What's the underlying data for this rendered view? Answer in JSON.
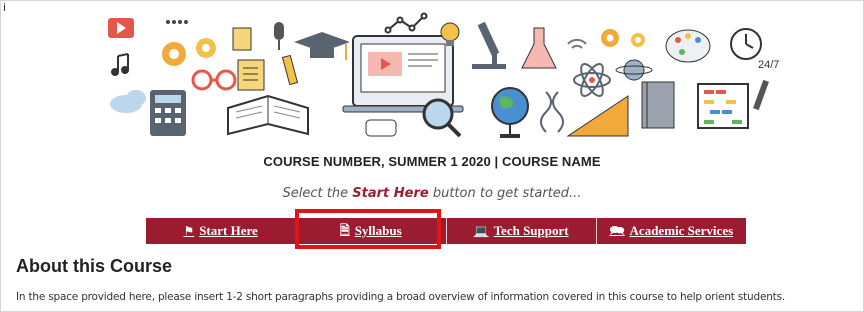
{
  "cursor_glyph": "i",
  "banner": {
    "clock_label": "24/7",
    "icons": [
      "video-play-icon",
      "gear-icon",
      "checklist-icon",
      "microphone-icon",
      "graduation-cap-icon",
      "laptop-video-icon",
      "line-chart-icon",
      "lightbulb-icon",
      "microscope-icon",
      "flask-icon",
      "wifi-icon",
      "atom-icon",
      "planet-icon",
      "palette-icon",
      "clock-icon",
      "calculator-icon",
      "eyeglasses-icon",
      "open-book-icon",
      "magnifier-icon",
      "globe-icon",
      "dna-icon",
      "ruler-triangle-icon",
      "notebook-icon",
      "abacus-icon",
      "music-note-icon",
      "cloud-icon"
    ]
  },
  "course_title": "COURSE NUMBER, SUMMER 1 2020 | COURSE NAME",
  "instruction": {
    "before": "Select the ",
    "emphasis": "Start Here",
    "after": " button to get started..."
  },
  "nav": {
    "buttons": [
      {
        "label": "Start Here",
        "icon": "flag-icon",
        "glyph": "⚑"
      },
      {
        "label": "Syllabus",
        "icon": "document-icon",
        "glyph": "🗎"
      },
      {
        "label": "Tech Support",
        "icon": "laptop-icon",
        "glyph": "💻"
      },
      {
        "label": "Academic Services",
        "icon": "chat-icon",
        "glyph": "🗪"
      }
    ]
  },
  "section_heading": "About this Course",
  "overview_text": "In the space provided here, please insert 1-2 short paragraphs providing a broad overview of information covered in this course to help orient students.",
  "colors": {
    "nav_background": "#9b1c31",
    "highlight": "#e11414",
    "emphasis": "#9b1c31"
  }
}
